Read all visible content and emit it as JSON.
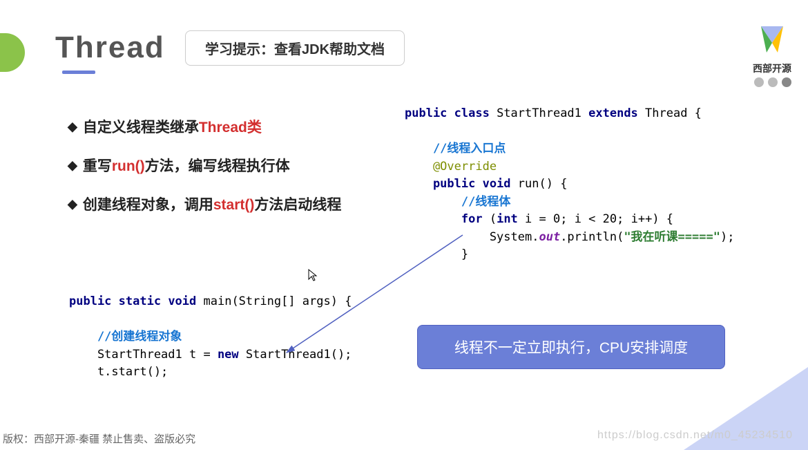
{
  "title": "Thread",
  "hint": "学习提示：查看JDK帮助文档",
  "logoText": "西部开源",
  "bullets": {
    "b1a": "自定义线程类继承",
    "b1b": "Thread类",
    "b2a": "重写",
    "b2b": "run()",
    "b2c": "方法，编写线程执行体",
    "b3a": "创建线程对象，调用",
    "b3b": "start()",
    "b3c": "方法启动线程"
  },
  "codeTop": {
    "l1a": "public",
    "l1b": " class",
    "l1c": " StartThread1 ",
    "l1d": "extends",
    "l1e": " Thread {",
    "l2": "    //线程入口点",
    "l3": "    @Override",
    "l4a": "    public",
    "l4b": " void",
    "l4c": " run() {",
    "l5": "        //线程体",
    "l6a": "        for",
    "l6b": " (",
    "l6c": "int",
    "l6d": " i = ",
    "l6e": "0",
    "l6f": "; i < ",
    "l6g": "20",
    "l6h": "; i++) {",
    "l7a": "            System.",
    "l7b": "out",
    "l7c": ".println(",
    "l7d": "\"我在听课=====\"",
    "l7e": ");",
    "l8": "        }"
  },
  "codeBottom": {
    "l1a": "public",
    "l1b": " static",
    "l1c": " void",
    "l1d": " main(String[] args) {",
    "l2": "    //创建线程对象",
    "l3a": "    StartThread1 t = ",
    "l3b": "new",
    "l3c": " StartThread1();",
    "l4": "    t.start();"
  },
  "callout": "线程不一定立即执行，CPU安排调度",
  "footer": "版权：西部开源-秦疆   禁止售卖、盗版必究",
  "watermark": "https://blog.csdn.net/m0_45234510"
}
